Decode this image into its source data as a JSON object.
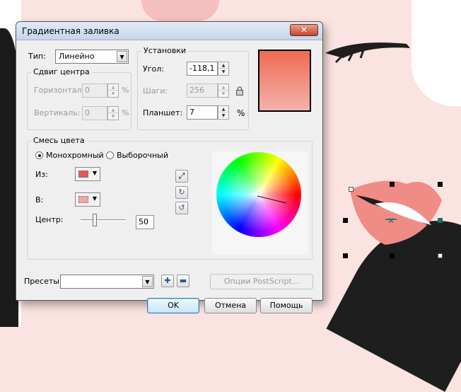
{
  "dialog": {
    "title": "Градиентная заливка",
    "close_glyph": "✕"
  },
  "type": {
    "label": "Тип:",
    "value": "Линейно"
  },
  "center_offset": {
    "legend": "Сдвиг центра",
    "horizontal_label": "Горизонталь:",
    "horizontal_value": "0",
    "vertical_label": "Вертикаль:",
    "vertical_value": "0",
    "unit": "%"
  },
  "settings": {
    "legend": "Установки",
    "angle_label": "Угол:",
    "angle_value": "-118,1",
    "steps_label": "Шаги:",
    "steps_value": "256",
    "edge_pad_label": "Планшет:",
    "edge_pad_value": "7",
    "unit": "%"
  },
  "color_blend": {
    "legend": "Смесь цвета",
    "mono_label": "Монохромный",
    "custom_label": "Выборочный",
    "from_label": "Из:",
    "to_label": "В:",
    "center_label": "Центр:",
    "center_value": "50",
    "mid_point": 0.32
  },
  "colors": {
    "from": "#e8584d",
    "to": "#f1a6a8",
    "preview_top": "#ee6a52",
    "preview_bottom": "#f5b2ac"
  },
  "presets": {
    "label": "Пресеты:",
    "value": "",
    "postscript_label": "Опции PostScript..."
  },
  "buttons": {
    "ok": "OK",
    "cancel": "Отмена",
    "help": "Помощь"
  }
}
